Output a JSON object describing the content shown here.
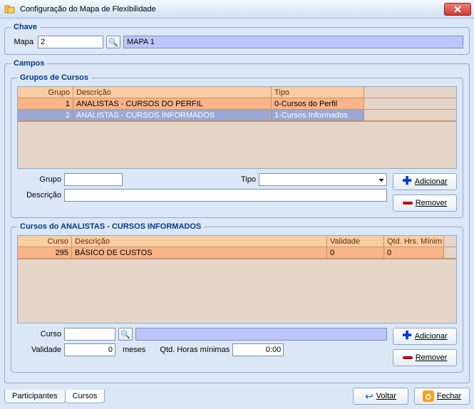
{
  "window": {
    "title": "Configuração do Mapa de Flexibilidade"
  },
  "chave": {
    "legend": "Chave",
    "mapa_label": "Mapa",
    "mapa_value": "2",
    "mapa_name": "MAPA 1"
  },
  "campos": {
    "legend": "Campos",
    "grupos": {
      "legend": "Grupos de Cursos",
      "headers": {
        "grupo": "Grupo",
        "descricao": "Descrição",
        "tipo": "Tipo"
      },
      "rows": [
        {
          "grupo": "1",
          "descricao": "ANALISTAS - CURSOS DO PERFIL",
          "tipo": "0-Cursos do Perfil"
        },
        {
          "grupo": "2",
          "descricao": "ANALISTAS - CURSOS INFORMADOS",
          "tipo": "1-Cursos Informados"
        }
      ],
      "form": {
        "grupo_label": "Grupo",
        "grupo_value": "",
        "tipo_label": "Tipo",
        "tipo_value": "",
        "descricao_label": "Descrição",
        "descricao_value": ""
      },
      "buttons": {
        "add": "Adicionar",
        "remove": "Remover"
      }
    },
    "cursos": {
      "legend": "Cursos do ANALISTAS - CURSOS INFORMADOS",
      "headers": {
        "curso": "Curso",
        "descricao": "Descrição",
        "validade": "Validade",
        "qtd": "Qtd. Hrs. Mínim"
      },
      "rows": [
        {
          "curso": "295",
          "descricao": "BÁSICO DE CUSTOS",
          "validade": "0",
          "qtd": "0"
        }
      ],
      "form": {
        "curso_label": "Curso",
        "curso_value": "",
        "curso_name": "",
        "validade_label": "Validade",
        "validade_value": "0",
        "validade_unit": "meses",
        "qtd_label": "Qtd. Horas mínimas",
        "qtd_value": "0:00"
      },
      "buttons": {
        "add": "Adicionar",
        "remove": "Remover"
      }
    }
  },
  "tabs": {
    "participantes": "Participantes",
    "cursos": "Cursos"
  },
  "footer": {
    "voltar": "Voltar",
    "fechar": "Fechar"
  }
}
